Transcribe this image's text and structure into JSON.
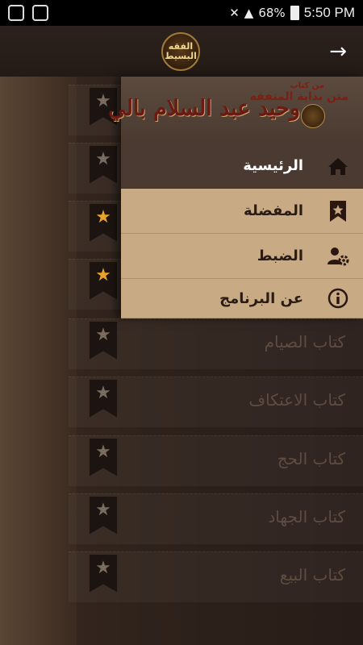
{
  "status": {
    "battery": "68%",
    "time": "5:50 PM"
  },
  "toolbar": {
    "logo_text": "الفقه البسيط",
    "forward_icon": "arrow-right-icon"
  },
  "drawer": {
    "header": {
      "line1": "من كتاب",
      "line2": "متن بداية المتفقه",
      "author": "وحيد عبد السلام بالي"
    },
    "items": [
      {
        "label": "الرئيسية",
        "icon": "home-icon"
      },
      {
        "label": "المفضلة",
        "icon": "bookmark-star-icon"
      },
      {
        "label": "الضبط",
        "icon": "user-settings-icon"
      },
      {
        "label": "عن البرنامج",
        "icon": "info-icon"
      }
    ]
  },
  "list": {
    "rows": [
      {
        "title": "",
        "favorite": false
      },
      {
        "title": "",
        "favorite": false
      },
      {
        "title": "",
        "favorite": true
      },
      {
        "title": "",
        "favorite": true
      },
      {
        "title": "كتاب الصيام",
        "favorite": false
      },
      {
        "title": "كتاب الاعتكاف",
        "favorite": false
      },
      {
        "title": "كتاب الحج",
        "favorite": false
      },
      {
        "title": "كتاب الجهاد",
        "favorite": false
      },
      {
        "title": "كتاب البيع",
        "favorite": false
      }
    ]
  }
}
